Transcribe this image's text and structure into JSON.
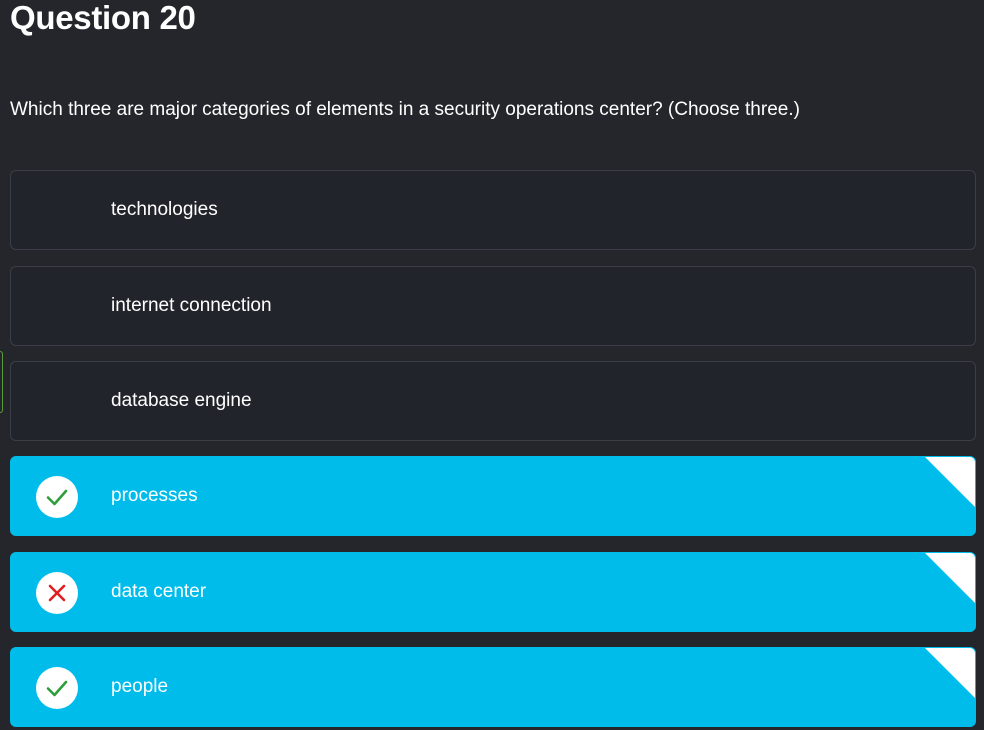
{
  "question": {
    "title": "Question 20",
    "text": "Which three are major categories of elements in a security operations center? (Choose three.)"
  },
  "options": [
    {
      "label": "technologies",
      "selected": false,
      "status": "none"
    },
    {
      "label": "internet connection",
      "selected": false,
      "status": "none"
    },
    {
      "label": "database engine",
      "selected": false,
      "status": "none"
    },
    {
      "label": "processes",
      "selected": true,
      "status": "correct",
      "icon": "checkmark-icon"
    },
    {
      "label": "data center",
      "selected": true,
      "status": "incorrect",
      "icon": "x-mark-icon"
    },
    {
      "label": "people",
      "selected": true,
      "status": "correct",
      "icon": "checkmark-icon"
    }
  ],
  "colors": {
    "background": "#24262b",
    "option_background": "#22242c",
    "selected_background": "#00bcea",
    "correct": "#2e9e3a",
    "incorrect": "#e02020"
  }
}
